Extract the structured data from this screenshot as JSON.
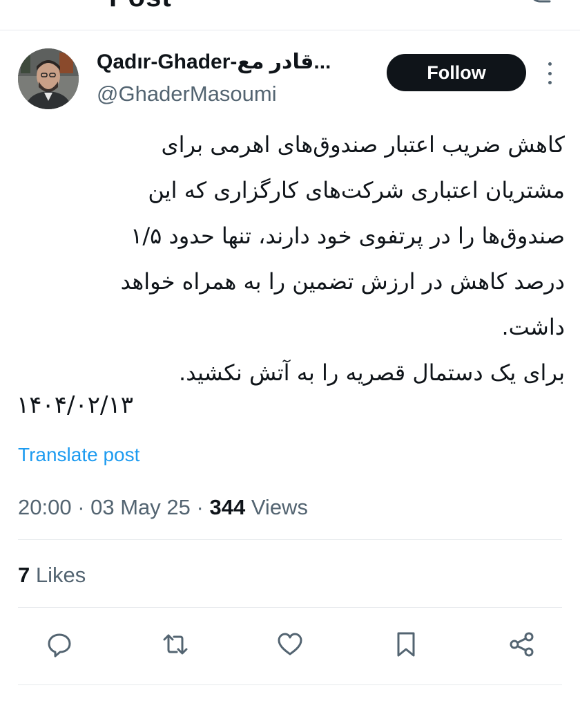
{
  "header": {
    "title": "Post",
    "back_icon": "arrow-left-icon",
    "reply_icon": "reply-arrow-icon"
  },
  "author": {
    "display_name": "Qadır-Ghader-قادر مع...",
    "handle": "@GhaderMasoumi",
    "avatar_icon": "profile-photo"
  },
  "follow_button": {
    "label": "Follow"
  },
  "more_icon": "more-vertical-icon",
  "tweet": {
    "lines": [
      "کاهش ضریب اعتبار صندوق‌های اهرمی برای",
      "مشتریان اعتباری شرکت‌های کارگزاری که این",
      "صندوق‌ها را در پرتفوی خود دارند، تنها حدود ۱/۵",
      "درصد کاهش در ارزش تضمین را به همراه خواهد",
      "داشت.",
      "برای یک دستمال قصریه را به آتش نکشید."
    ],
    "date": "۱۴۰۴/۰۲/۱۳"
  },
  "translate_label": "Translate post",
  "meta": {
    "time": "20:00",
    "sep1": " · ",
    "date": "03 May 25",
    "sep2": " · ",
    "views_count": "344",
    "views_label": " Views"
  },
  "likes": {
    "count": "7",
    "label": " Likes"
  },
  "actions": {
    "reply": "reply-icon",
    "retweet": "retweet-icon",
    "like": "heart-icon",
    "bookmark": "bookmark-icon",
    "share": "share-icon"
  },
  "colors": {
    "text": "#0f1419",
    "muted": "#536471",
    "link": "#1d9bf0",
    "border": "#e6e9ec",
    "button": "#0f1419"
  }
}
